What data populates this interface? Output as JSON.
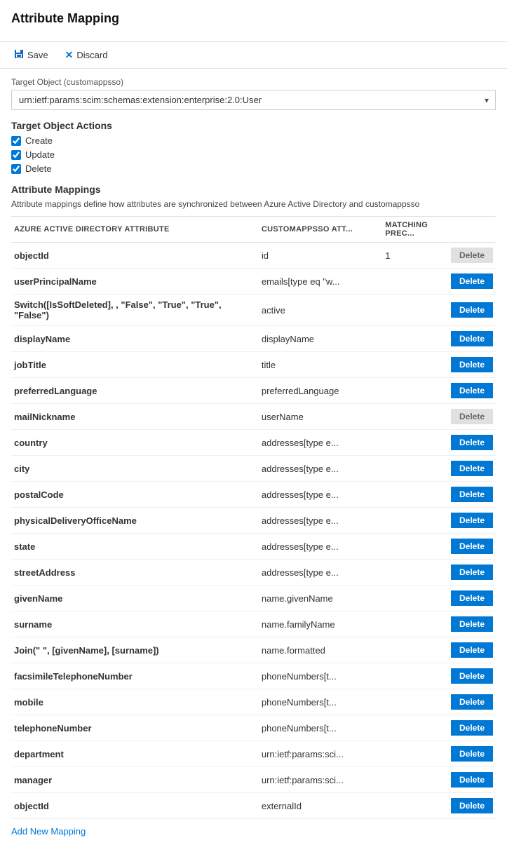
{
  "page": {
    "title": "Attribute Mapping"
  },
  "toolbar": {
    "save_label": "Save",
    "discard_label": "Discard"
  },
  "target_object": {
    "label": "Target Object (customappsso)",
    "value": "urn:ietf:params:scim:schemas:extension:enterprise:2.0:User"
  },
  "target_object_actions": {
    "title": "Target Object Actions",
    "actions": [
      {
        "label": "Create",
        "checked": true
      },
      {
        "label": "Update",
        "checked": true
      },
      {
        "label": "Delete",
        "checked": true
      }
    ]
  },
  "attribute_mappings": {
    "section_title": "Attribute Mappings",
    "description": "Attribute mappings define how attributes are synchronized between Azure Active Directory and customappsso",
    "columns": {
      "aad": "AZURE ACTIVE DIRECTORY ATTRIBUTE",
      "custom": "CUSTOMAPPSSO ATT...",
      "match": "MATCHING PREC...",
      "action": ""
    },
    "rows": [
      {
        "aad": "objectId",
        "custom": "id",
        "match": "1",
        "deletable": false
      },
      {
        "aad": "userPrincipalName",
        "custom": "emails[type eq \"w...",
        "match": "",
        "deletable": true
      },
      {
        "aad": "Switch([IsSoftDeleted], , \"False\", \"True\", \"True\", \"False\")",
        "custom": "active",
        "match": "",
        "deletable": true
      },
      {
        "aad": "displayName",
        "custom": "displayName",
        "match": "",
        "deletable": true
      },
      {
        "aad": "jobTitle",
        "custom": "title",
        "match": "",
        "deletable": true
      },
      {
        "aad": "preferredLanguage",
        "custom": "preferredLanguage",
        "match": "",
        "deletable": true
      },
      {
        "aad": "mailNickname",
        "custom": "userName",
        "match": "",
        "deletable": false
      },
      {
        "aad": "country",
        "custom": "addresses[type e...",
        "match": "",
        "deletable": true
      },
      {
        "aad": "city",
        "custom": "addresses[type e...",
        "match": "",
        "deletable": true
      },
      {
        "aad": "postalCode",
        "custom": "addresses[type e...",
        "match": "",
        "deletable": true
      },
      {
        "aad": "physicalDeliveryOfficeName",
        "custom": "addresses[type e...",
        "match": "",
        "deletable": true
      },
      {
        "aad": "state",
        "custom": "addresses[type e...",
        "match": "",
        "deletable": true
      },
      {
        "aad": "streetAddress",
        "custom": "addresses[type e...",
        "match": "",
        "deletable": true
      },
      {
        "aad": "givenName",
        "custom": "name.givenName",
        "match": "",
        "deletable": true
      },
      {
        "aad": "surname",
        "custom": "name.familyName",
        "match": "",
        "deletable": true
      },
      {
        "aad": "Join(\" \", [givenName], [surname])",
        "custom": "name.formatted",
        "match": "",
        "deletable": true
      },
      {
        "aad": "facsimileTelephoneNumber",
        "custom": "phoneNumbers[t...",
        "match": "",
        "deletable": true
      },
      {
        "aad": "mobile",
        "custom": "phoneNumbers[t...",
        "match": "",
        "deletable": true
      },
      {
        "aad": "telephoneNumber",
        "custom": "phoneNumbers[t...",
        "match": "",
        "deletable": true
      },
      {
        "aad": "department",
        "custom": "urn:ietf:params:sci...",
        "match": "",
        "deletable": true
      },
      {
        "aad": "manager",
        "custom": "urn:ietf:params:sci...",
        "match": "",
        "deletable": true
      },
      {
        "aad": "objectId",
        "custom": "externalId",
        "match": "",
        "deletable": true
      }
    ]
  },
  "add_new_mapping": {
    "label": "Add New Mapping"
  },
  "delete_label": "Delete"
}
